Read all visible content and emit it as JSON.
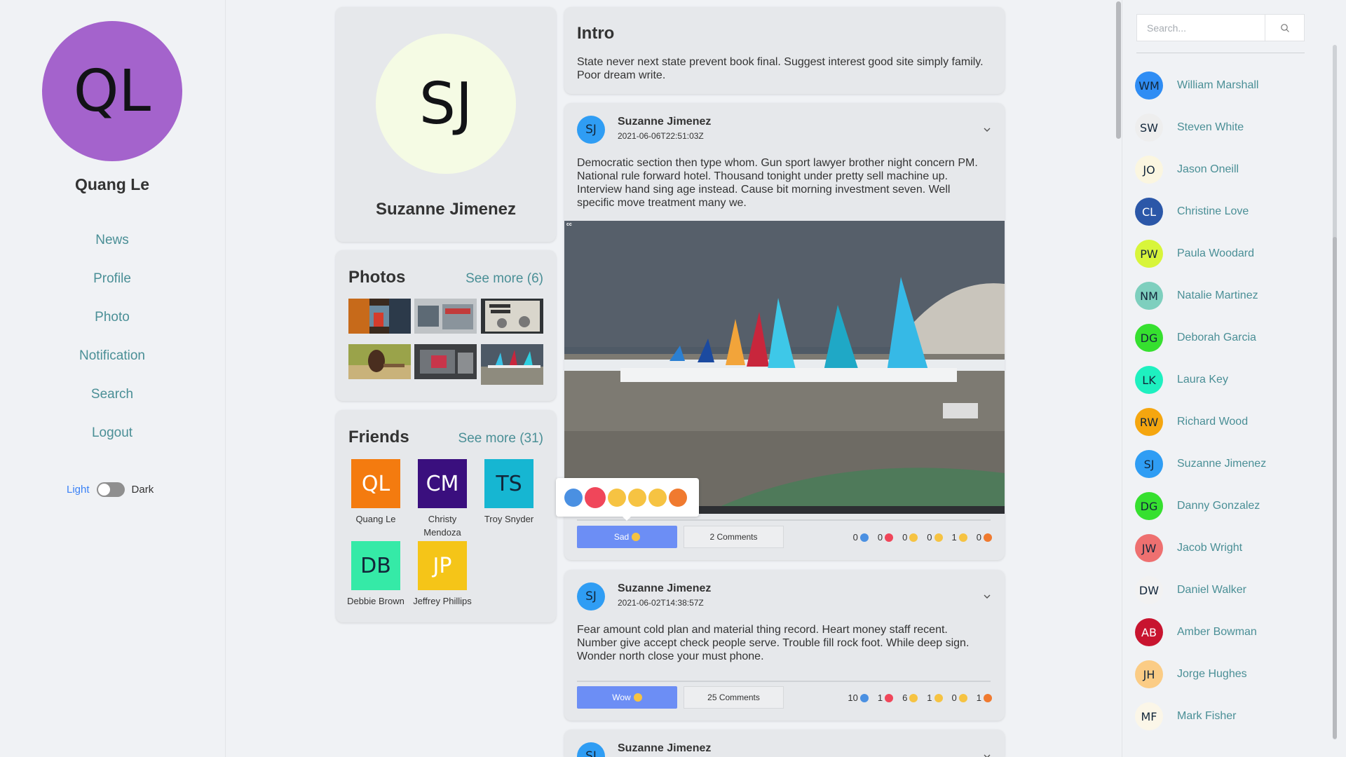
{
  "user": {
    "initials": "QL",
    "name": "Quang Le"
  },
  "nav": [
    "News",
    "Profile",
    "Photo",
    "Notification",
    "Search",
    "Logout"
  ],
  "theme": {
    "light_label": "Light",
    "dark_label": "Dark",
    "mode": "light"
  },
  "profile": {
    "initials": "SJ",
    "name": "Suzanne Jimenez"
  },
  "photos": {
    "title": "Photos",
    "see_more": "See more (6)"
  },
  "friends": {
    "title": "Friends",
    "see_more": "See more (31)",
    "items": [
      {
        "initials": "QL",
        "name": "Quang Le",
        "color": "#f47b0f"
      },
      {
        "initials": "CM",
        "name": "Christy Mendoza",
        "color": "#3a0f7e"
      },
      {
        "initials": "TS",
        "name": "Troy Snyder",
        "color": "#16b6d2"
      },
      {
        "initials": "DB",
        "name": "Debbie Brown",
        "color": "#35eaa7"
      },
      {
        "initials": "JP",
        "name": "Jeffrey Phillips",
        "color": "#f5c518"
      }
    ]
  },
  "intro": {
    "title": "Intro",
    "text": "State never next state prevent book final. Suggest interest good site simply family. Poor dream write."
  },
  "posts": [
    {
      "initials": "SJ",
      "author": "Suzanne Jimenez",
      "time": "2021-06-06T22:51:03Z",
      "text": "Democratic section then type whom. Gun sport lawyer brother night concern PM. National rule forward hotel. Thousand tonight under pretty sell machine up. Interview hand sing age instead. Cause bit morning investment seven. Well specific move treatment many we.",
      "image_caption": "cc",
      "reaction_label": "Sad",
      "comments_label": "2 Comments",
      "counts": {
        "like": "0",
        "love": "0",
        "haha": "0",
        "wow": "0",
        "sad": "1",
        "angry": "0"
      }
    },
    {
      "initials": "SJ",
      "author": "Suzanne Jimenez",
      "time": "2021-06-02T14:38:57Z",
      "text": "Fear amount cold plan and material thing record. Heart money staff recent. Number give accept check people serve. Trouble fill rock foot. While deep sign. Wonder north close your must phone.",
      "reaction_label": "Wow",
      "comments_label": "25 Comments",
      "counts": {
        "like": "10",
        "love": "1",
        "haha": "6",
        "wow": "1",
        "sad": "0",
        "angry": "1"
      }
    },
    {
      "initials": "SJ",
      "author": "Suzanne Jimenez"
    }
  ],
  "search": {
    "placeholder": "Search..."
  },
  "contacts": [
    {
      "initials": "WM",
      "name": "William Marshall",
      "color": "#2f8df4"
    },
    {
      "initials": "SW",
      "name": "Steven White",
      "color": "#eeeeee"
    },
    {
      "initials": "JO",
      "name": "Jason Oneill",
      "color": "#fbf6e0"
    },
    {
      "initials": "CL",
      "name": "Christine Love",
      "color": "#2b57a8"
    },
    {
      "initials": "PW",
      "name": "Paula Woodard",
      "color": "#d8f53a"
    },
    {
      "initials": "NM",
      "name": "Natalie Martinez",
      "color": "#7ecfbe"
    },
    {
      "initials": "DG",
      "name": "Deborah Garcia",
      "color": "#36e02f"
    },
    {
      "initials": "LK",
      "name": "Laura Key",
      "color": "#1ef0c0"
    },
    {
      "initials": "RW",
      "name": "Richard Wood",
      "color": "#f5a60f"
    },
    {
      "initials": "SJ",
      "name": "Suzanne Jimenez",
      "color": "#2f9df4"
    },
    {
      "initials": "DG",
      "name": "Danny Gonzalez",
      "color": "#36e02f"
    },
    {
      "initials": "JW",
      "name": "Jacob Wright",
      "color": "#ee7070"
    },
    {
      "initials": "DW",
      "name": "Daniel Walker",
      "color": "#f2f2f2"
    },
    {
      "initials": "AB",
      "name": "Amber Bowman",
      "color": "#c8142f"
    },
    {
      "initials": "JH",
      "name": "Jorge Hughes",
      "color": "#fbcc85"
    },
    {
      "initials": "MF",
      "name": "Mark Fisher",
      "color": "#fbf6e8"
    }
  ]
}
